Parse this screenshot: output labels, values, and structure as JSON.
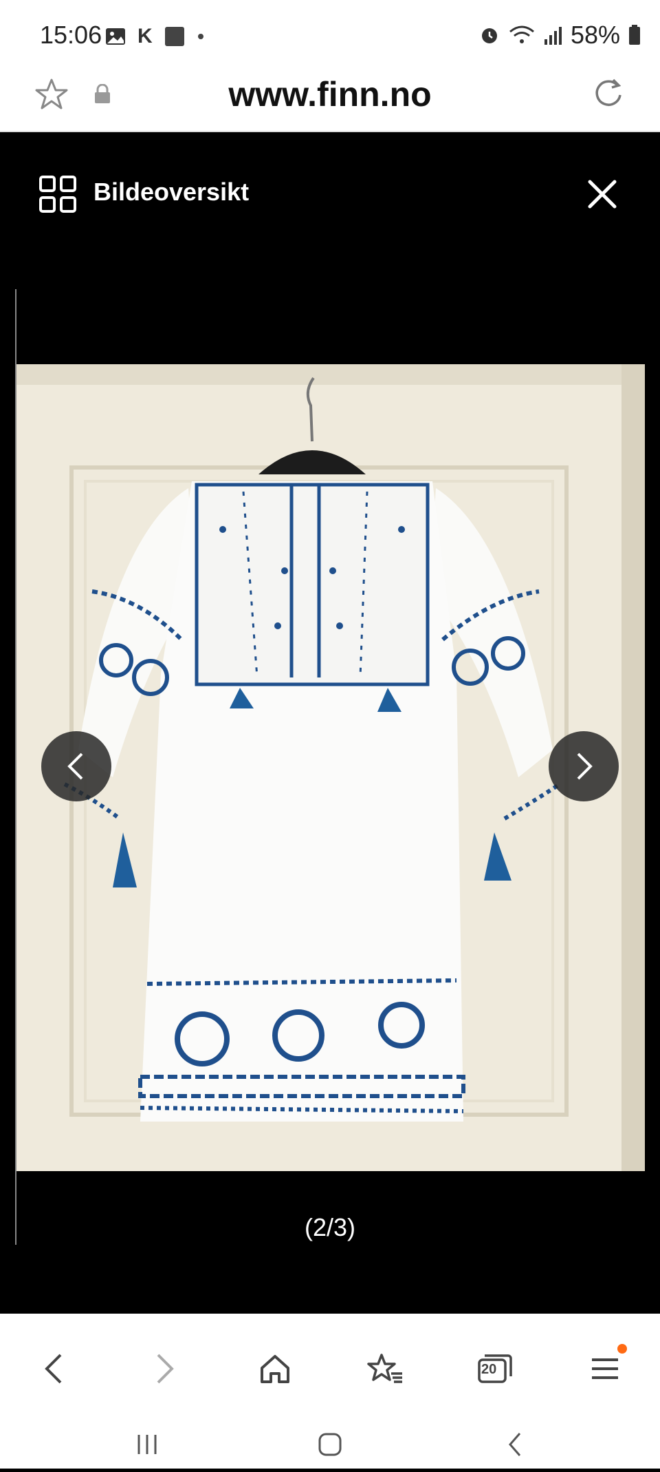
{
  "status_bar": {
    "time": "15:06",
    "letter_icon": "K",
    "battery": "58%",
    "icons": [
      "image-icon",
      "k-icon",
      "square-icon",
      "dot-icon",
      "alarm-icon",
      "wifi-icon",
      "signal-icon",
      "battery-icon"
    ]
  },
  "browser": {
    "url": "www.finn.no",
    "star_icon": "star-icon",
    "lock_icon": "lock-icon",
    "reload_icon": "reload-icon"
  },
  "viewer": {
    "overview_label": "Bildeoversikt",
    "counter": "(2/3)",
    "colors": {
      "background": "#000000",
      "photo_wall": "#f1ede0",
      "dress": "#fbfbfa",
      "embroidery": "#1f4f8c"
    }
  },
  "bottom_nav": {
    "items": [
      "back-icon",
      "forward-icon",
      "home-icon",
      "bookmarks-icon",
      "tabs-icon",
      "menu-icon"
    ],
    "tabs_count": "20",
    "accent": "#ff6a13"
  },
  "system_nav": {
    "items": [
      "recents-icon",
      "home-button-icon",
      "back-button-icon"
    ]
  }
}
